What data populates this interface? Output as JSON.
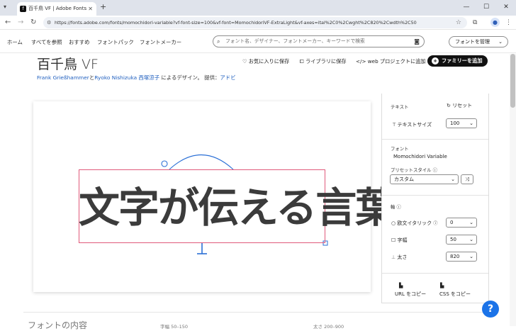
{
  "browser": {
    "tab_title": "百千鳥 VF | Adobe Fonts",
    "favicon": "adobe-fonts-icon",
    "url": "https://fonts.adobe.com/fonts/momochidori-variable?vf-font-size=100&vf-font=MomochidoriVF-ExtraLight&vf-axes=ital%2C0%2Cwght%2C820%2Cwdth%2C50"
  },
  "site_header": {
    "nav": [
      "ホーム",
      "すべてを参照",
      "おすすめ",
      "フォントパック",
      "フォントメーカー"
    ],
    "search_placeholder": "フォント名、デザイナー、フォントメーカー、キーワードで検索",
    "manage_button": "フォントを管理"
  },
  "family": {
    "title": "百千鳥 VF",
    "designer1": "Frank Grießhammer",
    "conj": "と",
    "designer2": "Ryoko Nishizuka 西塚涼子",
    "suffix": " によるデザイン。 提供：",
    "foundry": "アドビ",
    "actions": {
      "favorite": "お気に入りに保存",
      "library": "ライブラリに保存",
      "web_project": "web プロジェクトに追加",
      "add_family": "ファミリーを追加"
    }
  },
  "preview": {
    "sample_text": "文字が伝える言葉"
  },
  "panel": {
    "text_section": "テキスト",
    "reset": "リセット",
    "text_size_label": "テキストサイズ",
    "text_size_value": "100",
    "font_section": "フォント",
    "font_name": "Momochidori Variable",
    "preset_label": "プリセットスタイル",
    "preset_value": "カスタム",
    "axes_section": "軸",
    "axis_italic_label": "欧文イタリック",
    "axis_italic_value": "0",
    "axis_width_label": "字幅",
    "axis_width_value": "50",
    "axis_weight_label": "太さ",
    "axis_weight_value": "820",
    "copy_url": "URL をコピー",
    "copy_css": "CSS をコピー"
  },
  "bottom": {
    "section_title": "フォントの内容",
    "width_range": "字幅 50–150",
    "weight_range": "太さ 200–900"
  },
  "help_label": "?",
  "colors": {
    "selection_box": "#e05a7b",
    "handle_blue": "#2a6fd6",
    "link_blue": "#1f5fbf"
  }
}
